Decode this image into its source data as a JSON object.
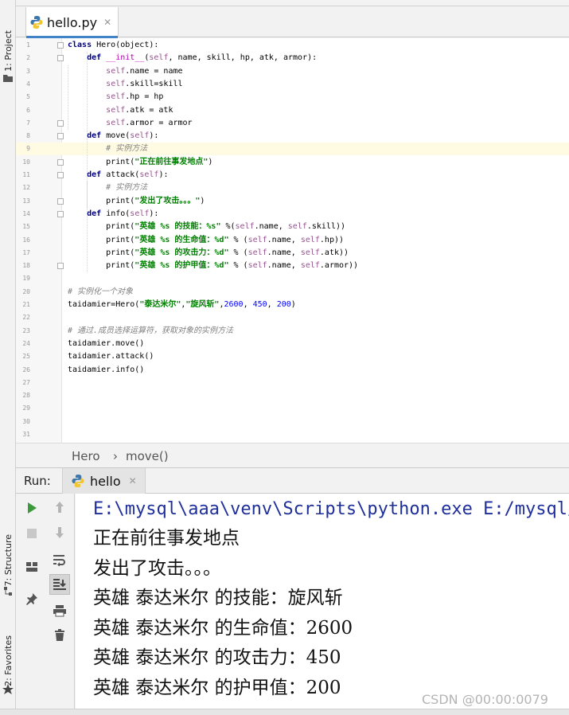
{
  "editor": {
    "file_tab": "hello.py",
    "lines": [
      [
        [
          "kw",
          "class "
        ],
        [
          "n",
          "Hero(object):"
        ]
      ],
      [
        [
          "n",
          "    "
        ],
        [
          "kw",
          "def "
        ],
        [
          "magic",
          "__init__"
        ],
        [
          "n",
          "("
        ],
        [
          "self",
          "self"
        ],
        [
          "n",
          ", name, skill, hp, atk, armor):"
        ]
      ],
      [
        [
          "n",
          "        "
        ],
        [
          "self",
          "self"
        ],
        [
          "n",
          ".name = name"
        ]
      ],
      [
        [
          "n",
          "        "
        ],
        [
          "self",
          "self"
        ],
        [
          "n",
          ".skill=skill"
        ]
      ],
      [
        [
          "n",
          "        "
        ],
        [
          "self",
          "self"
        ],
        [
          "n",
          ".hp = hp"
        ]
      ],
      [
        [
          "n",
          "        "
        ],
        [
          "self",
          "self"
        ],
        [
          "n",
          ".atk = atk"
        ]
      ],
      [
        [
          "n",
          "        "
        ],
        [
          "self",
          "self"
        ],
        [
          "n",
          ".armor = armor"
        ]
      ],
      [
        [
          "n",
          "    "
        ],
        [
          "kw",
          "def "
        ],
        [
          "n",
          "move("
        ],
        [
          "self",
          "self"
        ],
        [
          "n",
          "):"
        ]
      ],
      [
        [
          "n",
          "        "
        ],
        [
          "cmt",
          "# 实例方法"
        ]
      ],
      [
        [
          "n",
          "        print("
        ],
        [
          "str",
          "\"正在前往事发地点\""
        ],
        [
          "n",
          ")"
        ]
      ],
      [
        [
          "n",
          "    "
        ],
        [
          "kw",
          "def "
        ],
        [
          "n",
          "attack("
        ],
        [
          "self",
          "self"
        ],
        [
          "n",
          "):"
        ]
      ],
      [
        [
          "n",
          "        "
        ],
        [
          "cmt",
          "# 实例方法"
        ]
      ],
      [
        [
          "n",
          "        print("
        ],
        [
          "str",
          "\"发出了攻击。。。\""
        ],
        [
          "n",
          ")"
        ]
      ],
      [
        [
          "n",
          "    "
        ],
        [
          "kw",
          "def "
        ],
        [
          "n",
          "info("
        ],
        [
          "self",
          "self"
        ],
        [
          "n",
          "):"
        ]
      ],
      [
        [
          "n",
          "        print("
        ],
        [
          "str",
          "\"英雄 %s 的技能：%s\""
        ],
        [
          "n",
          " %("
        ],
        [
          "self",
          "self"
        ],
        [
          "n",
          ".name, "
        ],
        [
          "self",
          "self"
        ],
        [
          "n",
          ".skill))"
        ]
      ],
      [
        [
          "n",
          "        print("
        ],
        [
          "str",
          "\"英雄 %s 的生命值：%d\""
        ],
        [
          "n",
          " % ("
        ],
        [
          "self",
          "self"
        ],
        [
          "n",
          ".name, "
        ],
        [
          "self",
          "self"
        ],
        [
          "n",
          ".hp))"
        ]
      ],
      [
        [
          "n",
          "        print("
        ],
        [
          "str",
          "\"英雄 %s 的攻击力：%d\""
        ],
        [
          "n",
          " % ("
        ],
        [
          "self",
          "self"
        ],
        [
          "n",
          ".name, "
        ],
        [
          "self",
          "self"
        ],
        [
          "n",
          ".atk))"
        ]
      ],
      [
        [
          "n",
          "        print("
        ],
        [
          "str",
          "\"英雄 %s 的护甲值：%d\""
        ],
        [
          "n",
          " % ("
        ],
        [
          "self",
          "self"
        ],
        [
          "n",
          ".name, "
        ],
        [
          "self",
          "self"
        ],
        [
          "n",
          ".armor))"
        ]
      ],
      [],
      [
        [
          "cmt",
          "# 实例化一个对象"
        ]
      ],
      [
        [
          "n",
          "taidamier=Hero("
        ],
        [
          "str",
          "\"泰达米尔\""
        ],
        [
          "n",
          ","
        ],
        [
          "str",
          "\"旋风斩\""
        ],
        [
          "n",
          ","
        ],
        [
          "num",
          "2600"
        ],
        [
          "n",
          ", "
        ],
        [
          "num",
          "450"
        ],
        [
          "n",
          ", "
        ],
        [
          "num",
          "200"
        ],
        [
          "n",
          ")"
        ]
      ],
      [],
      [
        [
          "cmt",
          "# 通过.成员选择运算符，获取对象的实例方法"
        ]
      ],
      [
        [
          "n",
          "taidamier.move()"
        ]
      ],
      [
        [
          "n",
          "taidamier.attack()"
        ]
      ],
      [
        [
          "n",
          "taidamier.info()"
        ]
      ],
      [],
      [],
      [],
      [],
      []
    ]
  },
  "breadcrumb": {
    "class_name": "Hero",
    "method_name": "move()",
    "separator": "›"
  },
  "run": {
    "label": "Run:",
    "config_tab": "hello",
    "output": [
      "E:\\mysql\\aaa\\venv\\Scripts\\python.exe E:/mysql/",
      "正在前往事发地点",
      "发出了攻击。。。",
      "英雄 泰达米尔 的技能：旋风斩",
      "英雄 泰达米尔 的生命值：2600",
      "英雄 泰达米尔 的攻击力：450",
      "英雄 泰达米尔 的护甲值：200"
    ]
  },
  "side_tabs": {
    "project": "1: Project",
    "structure": "7: Structure",
    "favorites": "2: Favorites"
  },
  "watermark": "CSDN @00:00:0079",
  "icons": [
    "python-file-icon",
    "close-icon",
    "run-icon",
    "stop-icon",
    "rerun-up-icon",
    "rerun-down-icon",
    "soft-wrap-icon",
    "scroll-to-end-icon",
    "print-icon",
    "trash-icon",
    "layout-icon",
    "pin-icon",
    "folder-icon",
    "structure-icon",
    "star-icon"
  ],
  "colors": {
    "accent": "#4083c9",
    "run_green": "#3c9a3c",
    "current_line": "#fffbe3",
    "console_command": "#1f2f9a"
  }
}
